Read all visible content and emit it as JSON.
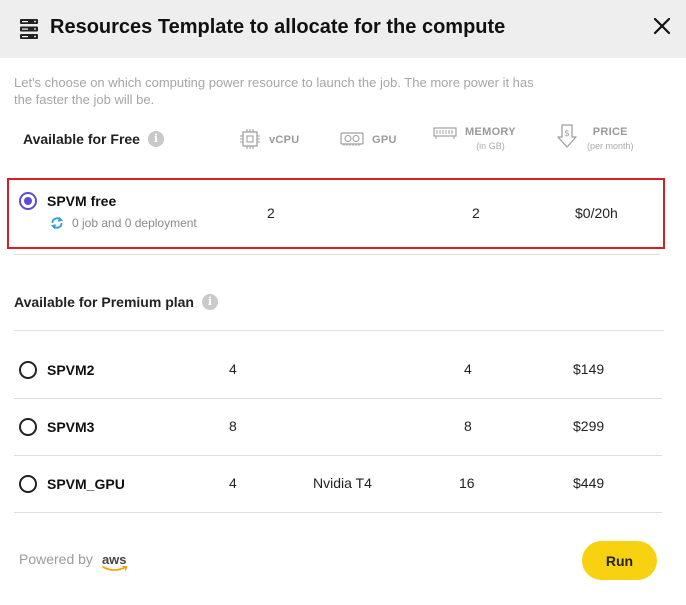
{
  "dialog": {
    "title": "Resources Template to allocate for the compute",
    "intro": "Let's choose on which computing power resource to launch the job. The more power it has the faster the job will be."
  },
  "columns": {
    "vcpu": "vCPU",
    "gpu": "GPU",
    "memory": "MEMORY",
    "memory_unit": "(in GB)",
    "price": "PRICE",
    "price_unit": "(per month)"
  },
  "free_section": {
    "title": "Available for Free",
    "plan": {
      "name": "SPVM free",
      "status": "0 job and 0 deployment",
      "vcpu": "2",
      "gpu": "",
      "memory": "2",
      "price": "$0/20h",
      "selected": true
    }
  },
  "premium_section": {
    "title": "Available for Premium plan",
    "plans": [
      {
        "name": "SPVM2",
        "vcpu": "4",
        "gpu": "",
        "memory": "4",
        "price": "$149"
      },
      {
        "name": "SPVM3",
        "vcpu": "8",
        "gpu": "",
        "memory": "8",
        "price": "$299"
      },
      {
        "name": "SPVM_GPU",
        "vcpu": "4",
        "gpu": "Nvidia T4",
        "memory": "16",
        "price": "$449"
      }
    ]
  },
  "footer": {
    "powered_by": "Powered by",
    "provider": "aws",
    "run_label": "Run"
  },
  "colors": {
    "accent": "#5b4dd6",
    "selection_border": "#d32027",
    "run_button": "#f8d210",
    "header_bg": "#eeeeee"
  },
  "icons": [
    "server-icon",
    "close-icon",
    "info-icon",
    "cpu-icon",
    "gpu-icon",
    "memory-icon",
    "price-icon",
    "sync-icon",
    "aws-logo"
  ]
}
